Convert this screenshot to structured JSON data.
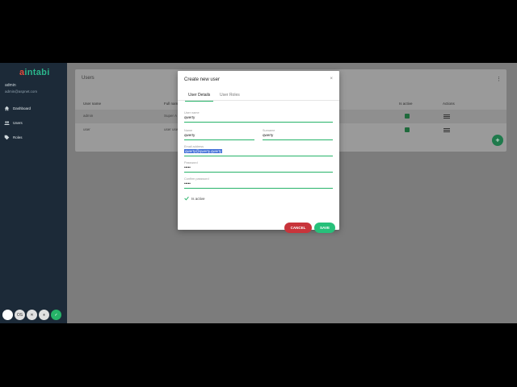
{
  "app": {
    "logo_prefix": "a",
    "logo_text": "intabi"
  },
  "sidebar": {
    "user_name": "admin",
    "user_email": "admin@aspnet.com",
    "items": [
      {
        "label": "Dashboard",
        "icon": "home-icon"
      },
      {
        "label": "Users",
        "icon": "users-icon"
      },
      {
        "label": "Roles",
        "icon": "tag-icon"
      }
    ],
    "bottom_buttons": [
      "",
      "OS",
      "✕",
      "⏸",
      "✓"
    ]
  },
  "users_card": {
    "title": "Users",
    "menu": "⋮",
    "columns": [
      "User name",
      "Full name",
      "Is active",
      "Actions"
    ],
    "rows": [
      {
        "user_name": "admin",
        "full_name": "Super A",
        "is_active": true
      },
      {
        "user_name": "user",
        "full_name": "user use",
        "is_active": true
      }
    ],
    "fab_label": "+"
  },
  "dialog": {
    "title": "Create new user",
    "close": "×",
    "tabs": [
      "User Details",
      "User Roles"
    ],
    "fields": {
      "username": {
        "label": "User name",
        "value": "qwerty"
      },
      "name": {
        "label": "Name",
        "value": "qwerty"
      },
      "surname": {
        "label": "Surname",
        "value": "qwerty"
      },
      "email": {
        "label": "Email address",
        "value": "qwerty@qwerty.qwerty"
      },
      "password": {
        "label": "Password",
        "value": "•••••"
      },
      "confirm": {
        "label": "Confirm password",
        "value": "•••••"
      }
    },
    "is_active_label": "Is active",
    "cancel_label": "CANCEL",
    "save_label": "SAVE"
  },
  "colors": {
    "accent": "#26b368",
    "cancel": "#c8343b",
    "sidebar": "#1c2a38"
  }
}
